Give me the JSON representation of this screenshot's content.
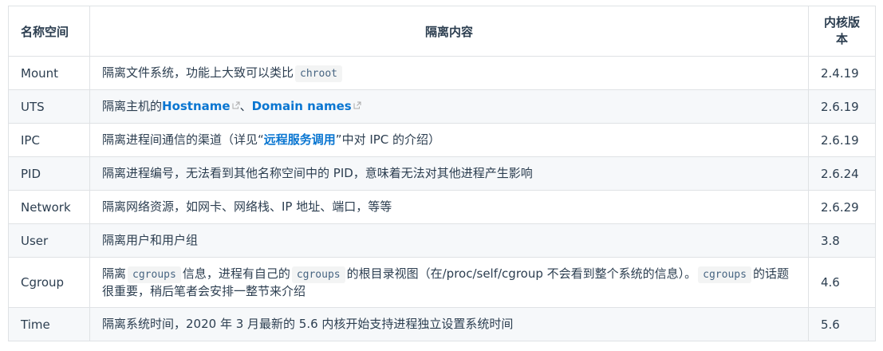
{
  "header": {
    "col_namespace": "名称空间",
    "col_content": "隔离内容",
    "col_version": "内核版本"
  },
  "rows": [
    {
      "name": "Mount",
      "content_pre": "隔离文件系统，功能上大致可以类比",
      "code": "chroot",
      "version": "2.4.19"
    },
    {
      "name": "UTS",
      "content_pre": "隔离主机的",
      "link1": "Hostname",
      "sep": "、",
      "link2": "Domain names",
      "version": "2.6.19"
    },
    {
      "name": "IPC",
      "content_pre": "隔离进程间通信的渠道（详见“",
      "link": "远程服务调用",
      "content_post": "”中对 IPC 的介绍）",
      "version": "2.6.19"
    },
    {
      "name": "PID",
      "content": "隔离进程编号，无法看到其他名称空间中的 PID，意味着无法对其他进程产生影响",
      "version": "2.6.24"
    },
    {
      "name": "Network",
      "content": "隔离网络资源，如网卡、网络栈、IP 地址、端口，等等",
      "version": "2.6.29"
    },
    {
      "name": "User",
      "content": "隔离用户和用户组",
      "version": "3.8"
    },
    {
      "name": "Cgroup",
      "t1": "隔离",
      "code1": "cgroups",
      "t2": "信息，进程有自己的",
      "code2": "cgroups",
      "t3": "的根目录视图（在/proc/self/cgroup 不会看到整个系统的信息）。",
      "code3": "cgroups",
      "t4": "的话题很重要，稍后笔者会安排一整节来介绍",
      "version": "4.6"
    },
    {
      "name": "Time",
      "content": "隔离系统时间，2020 年 3 月最新的 5.6 内核开始支持进程独立设置系统时间",
      "version": "5.6"
    }
  ],
  "colors": {
    "text": "#2c3e50",
    "link_green": "#3eaf7c",
    "link_blue": "#0a76d1",
    "border": "#dfe2e5",
    "stripe": "#f6f8fa"
  }
}
